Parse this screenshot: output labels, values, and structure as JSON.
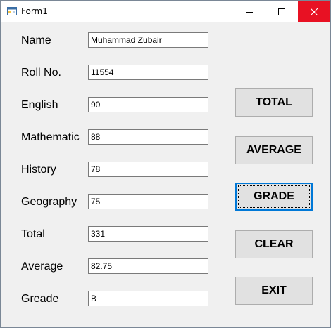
{
  "window": {
    "title": "Form1"
  },
  "caption_buttons": {
    "minimize_icon": "minimize-icon",
    "maximize_icon": "maximize-icon",
    "close_icon": "close-icon",
    "close_hover_color": "#e81123"
  },
  "form": {
    "fields": [
      {
        "label": "Name",
        "value": "Muhammad Zubair"
      },
      {
        "label": "Roll No.",
        "value": "11554"
      },
      {
        "label": "English",
        "value": "90"
      },
      {
        "label": "Mathematic",
        "value": "88"
      },
      {
        "label": "History",
        "value": "78"
      },
      {
        "label": "Geography",
        "value": "75"
      },
      {
        "label": "Total",
        "value": "331"
      },
      {
        "label": "Average",
        "value": "82.75"
      },
      {
        "label": "Greade",
        "value": "B"
      }
    ]
  },
  "buttons": {
    "total": "TOTAL",
    "average": "AVERAGE",
    "grade": "GRADE",
    "clear": "CLEAR",
    "exit": "EXIT"
  },
  "colors": {
    "focus_border": "#0078d7",
    "button_face": "#e1e1e1",
    "form_background": "#f0f0f0"
  }
}
